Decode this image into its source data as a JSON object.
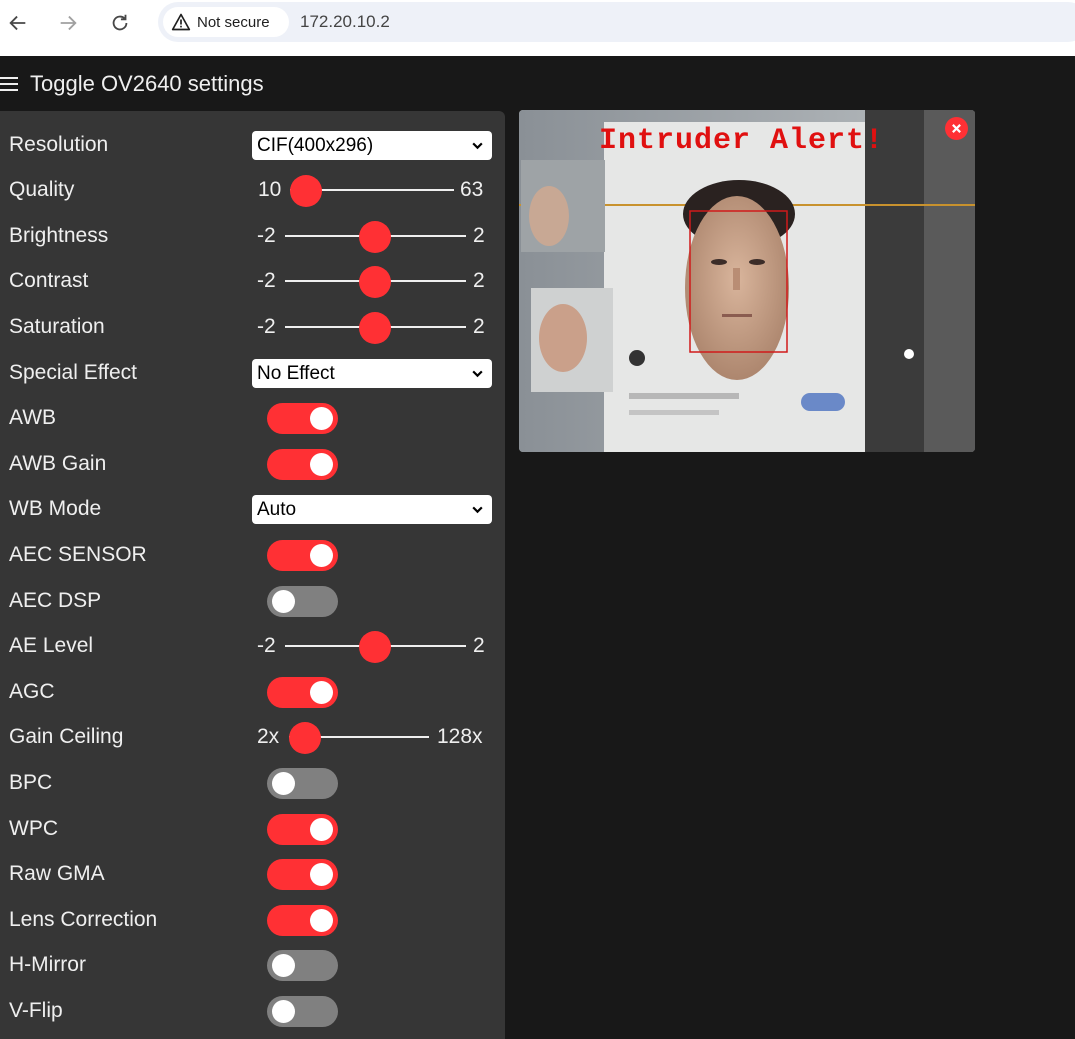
{
  "browser": {
    "security_label": "Not secure",
    "url": "172.20.10.2"
  },
  "menu": {
    "toggle_label": "Toggle OV2640 settings"
  },
  "settings": {
    "resolution": {
      "label": "Resolution",
      "value": "CIF(400x296)"
    },
    "quality": {
      "label": "Quality",
      "min": "10",
      "max": "63",
      "level": 0.0
    },
    "brightness": {
      "label": "Brightness",
      "min": "-2",
      "max": "2",
      "level": 0.5
    },
    "contrast": {
      "label": "Contrast",
      "min": "-2",
      "max": "2",
      "level": 0.5
    },
    "saturation": {
      "label": "Saturation",
      "min": "-2",
      "max": "2",
      "level": 0.5
    },
    "special_effect": {
      "label": "Special Effect",
      "value": "No Effect"
    },
    "awb": {
      "label": "AWB",
      "on": true
    },
    "awb_gain": {
      "label": "AWB Gain",
      "on": true
    },
    "wb_mode": {
      "label": "WB Mode",
      "value": "Auto"
    },
    "aec_sensor": {
      "label": "AEC SENSOR",
      "on": true
    },
    "aec_dsp": {
      "label": "AEC DSP",
      "on": false
    },
    "ae_level": {
      "label": "AE Level",
      "min": "-2",
      "max": "2",
      "level": 0.5
    },
    "agc": {
      "label": "AGC",
      "on": true
    },
    "gain_ceiling": {
      "label": "Gain Ceiling",
      "min": "2x",
      "max": "128x",
      "level": 0.0
    },
    "bpc": {
      "label": "BPC",
      "on": false
    },
    "wpc": {
      "label": "WPC",
      "on": true
    },
    "raw_gma": {
      "label": "Raw GMA",
      "on": true
    },
    "lens_correction": {
      "label": "Lens Correction",
      "on": true
    },
    "hmirror": {
      "label": "H-Mirror",
      "on": false
    },
    "vflip": {
      "label": "V-Flip",
      "on": false
    }
  },
  "stream": {
    "alert_text": "Intruder Alert!"
  },
  "colors": {
    "accent": "#ff3034",
    "panel": "#363636",
    "background": "#181818",
    "toggle_off": "#808080"
  }
}
